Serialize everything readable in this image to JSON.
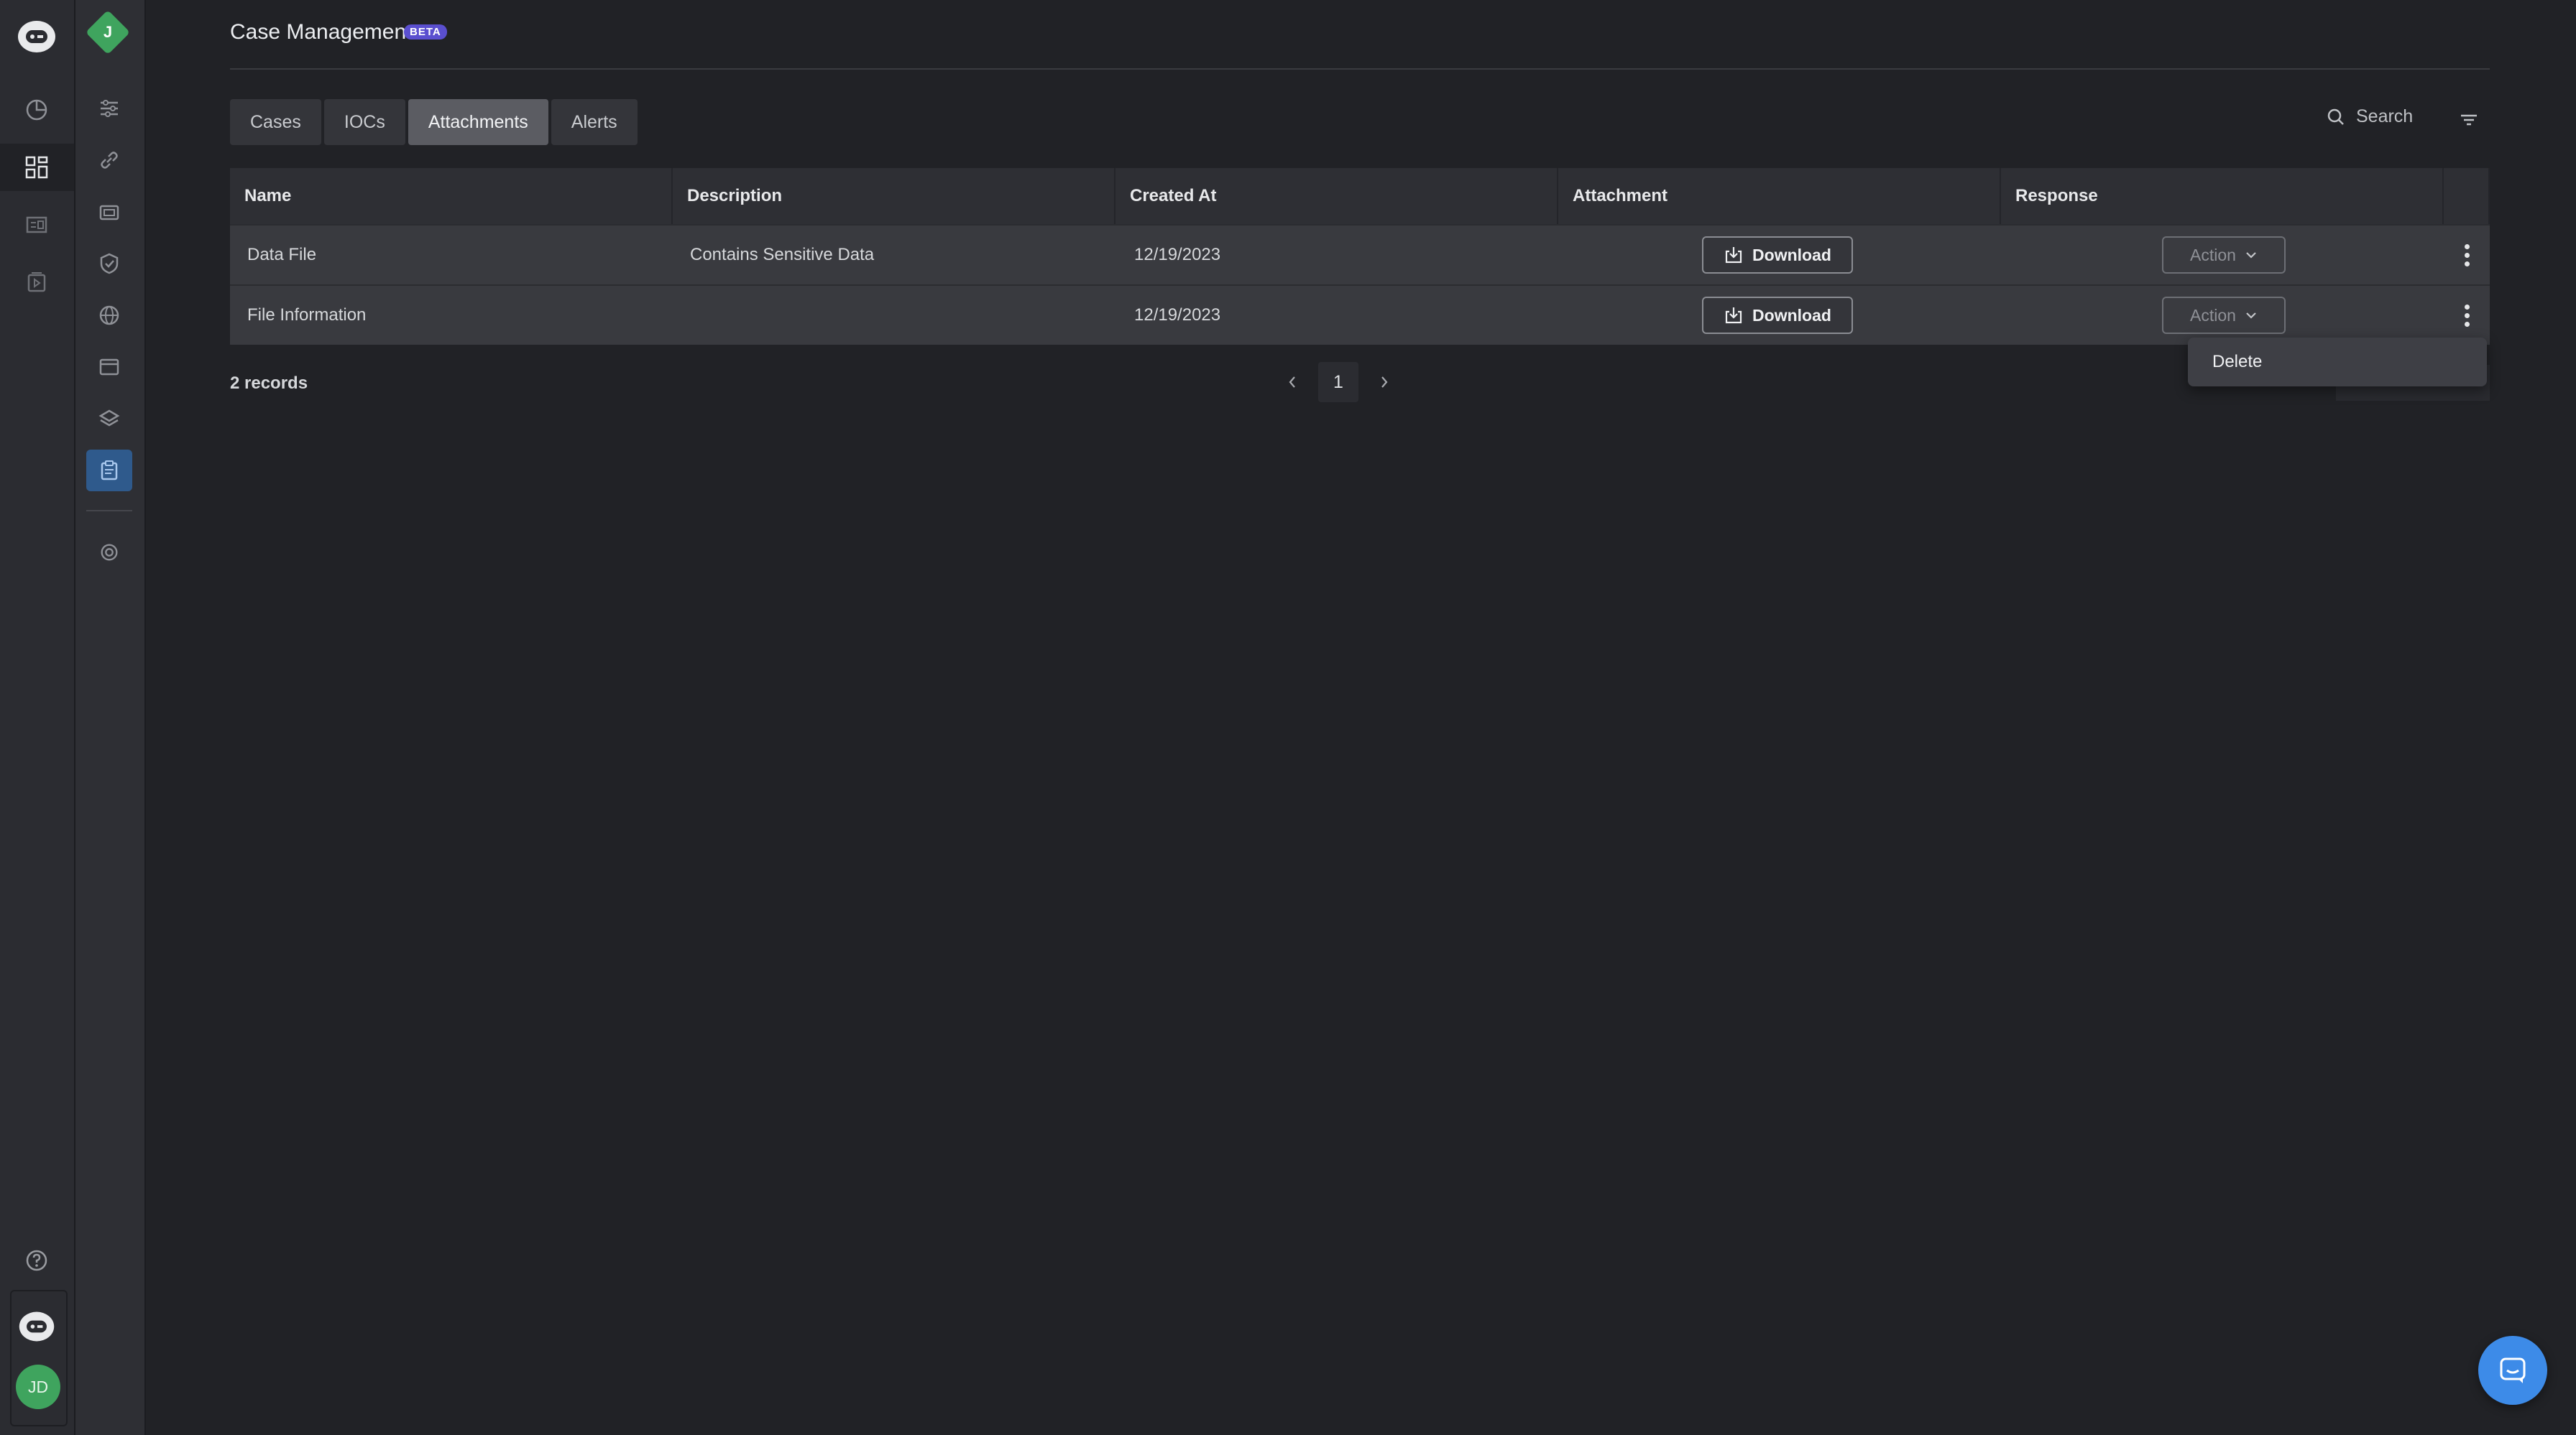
{
  "header": {
    "title": "Case Management",
    "badge": "BETA"
  },
  "workspace": {
    "initial": "J"
  },
  "user": {
    "initials": "JD"
  },
  "tabs": [
    {
      "label": "Cases",
      "active": false
    },
    {
      "label": "IOCs",
      "active": false
    },
    {
      "label": "Attachments",
      "active": true
    },
    {
      "label": "Alerts",
      "active": false
    }
  ],
  "search": {
    "placeholder": "Search"
  },
  "table": {
    "columns": [
      "Name",
      "Description",
      "Created At",
      "Attachment",
      "Response"
    ],
    "rows": [
      {
        "name": "Data File",
        "description": "Contains Sensitive Data",
        "created_at": "12/19/2023",
        "attachment_button": "Download",
        "response_button": "Action"
      },
      {
        "name": "File Information",
        "description": "",
        "created_at": "12/19/2023",
        "attachment_button": "Download",
        "response_button": "Action"
      }
    ]
  },
  "footer": {
    "records": "2 records",
    "current_page": "1"
  },
  "row_menu": {
    "items": [
      "Delete"
    ]
  },
  "colors": {
    "accent": "#3d8be8",
    "brand_green": "#3fa45e",
    "beta_badge": "#5a4fcf",
    "active_nav": "#2f5a8c"
  }
}
